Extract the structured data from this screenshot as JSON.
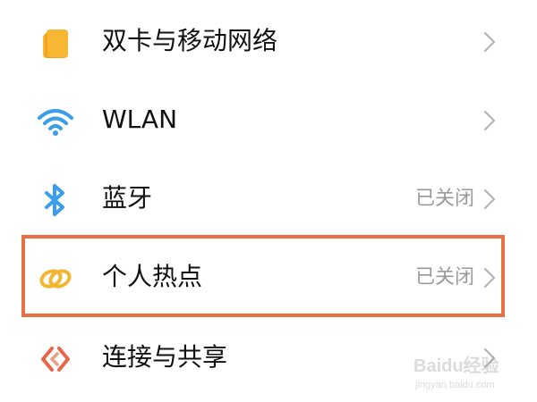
{
  "settings_list": {
    "items": [
      {
        "label": "双卡与移动网络",
        "status": "",
        "icon": "sim-card-icon"
      },
      {
        "label": "WLAN",
        "status": "",
        "icon": "wifi-icon"
      },
      {
        "label": "蓝牙",
        "status": "已关闭",
        "icon": "bluetooth-icon"
      },
      {
        "label": "个人热点",
        "status": "已关闭",
        "icon": "hotspot-icon"
      },
      {
        "label": "连接与共享",
        "status": "",
        "icon": "connection-share-icon"
      }
    ]
  },
  "watermark": {
    "text": "Baidu经验",
    "subtext": "jingyan.baidu.com"
  },
  "colors": {
    "sim_icon": "#f7b733",
    "wifi_icon": "#3a9ee8",
    "bluetooth_icon": "#3a9ee8",
    "hotspot_icon": "#f2b731",
    "share_icon": "#e8654a",
    "highlight_border": "#e87044",
    "status_text": "#9a9a9a",
    "chevron": "#b5b5b5"
  }
}
